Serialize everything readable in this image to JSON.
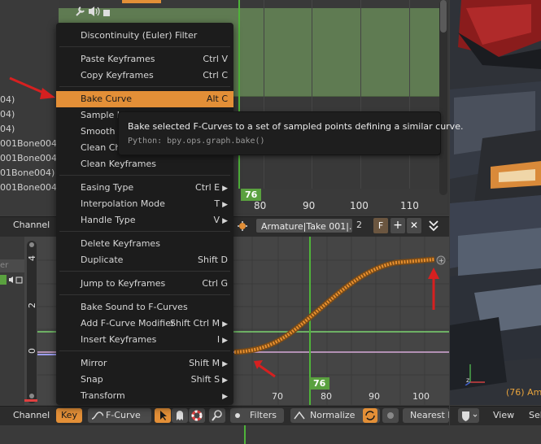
{
  "top_editor": {
    "channel_fragments": [
      "04)",
      "04)",
      "04)",
      "001Bone004)",
      "001Bone004)",
      "01Bone004)",
      "001Bone004)"
    ],
    "ruler_numbers": [
      "80",
      "90",
      "100",
      "110"
    ],
    "current_frame": "76"
  },
  "dopesheet_header": {
    "channel_menu": "Channel",
    "action_name": "Armature|Take 001|..",
    "action_users": "2",
    "fake_user": "F",
    "add_action": "+",
    "delete_action": "✕"
  },
  "graph_editor": {
    "y_ticks": [
      "4",
      "2",
      "0"
    ],
    "x_ticks": [
      "70",
      "80",
      "90",
      "100"
    ],
    "current_frame": "76",
    "channel_fragment": "er"
  },
  "bottom_header": {
    "channel_menu": "Channel",
    "key_menu": "Key",
    "mode": "F-Curve",
    "filters": "Filters",
    "normalize": "Normalize",
    "snap": "Nearest F"
  },
  "viewport": {
    "view_menu": "View",
    "select_menu": "Sel",
    "info_label": "(76) Am"
  },
  "context_menu": {
    "items": [
      {
        "label": "Discontinuity (Euler) Filter",
        "shortcut": ""
      },
      {
        "label": "Paste Keyframes",
        "shortcut": "Ctrl V"
      },
      {
        "label": "Copy Keyframes",
        "shortcut": "Ctrl C"
      },
      {
        "label": "Bake Curve",
        "shortcut": "Alt C"
      },
      {
        "label": "Sample Keyframes",
        "shortcut": ""
      },
      {
        "label": "Smooth Keys",
        "shortcut": ""
      },
      {
        "label": "Clean Channels",
        "shortcut": ""
      },
      {
        "label": "Clean Keyframes",
        "shortcut": ""
      },
      {
        "label": "Easing Type",
        "shortcut": "Ctrl E"
      },
      {
        "label": "Interpolation Mode",
        "shortcut": "T"
      },
      {
        "label": "Handle Type",
        "shortcut": "V"
      },
      {
        "label": "Delete Keyframes",
        "shortcut": ""
      },
      {
        "label": "Duplicate",
        "shortcut": "Shift D"
      },
      {
        "label": "Jump to Keyframes",
        "shortcut": "Ctrl G"
      },
      {
        "label": "Bake Sound to F-Curves",
        "shortcut": ""
      },
      {
        "label": "Add F-Curve Modifier",
        "shortcut": "Shift Ctrl M"
      },
      {
        "label": "Insert Keyframes",
        "shortcut": "I"
      },
      {
        "label": "Mirror",
        "shortcut": "Shift M"
      },
      {
        "label": "Snap",
        "shortcut": "Shift S"
      },
      {
        "label": "Transform",
        "shortcut": ""
      }
    ]
  },
  "tooltip": {
    "description": "Bake selected F-Curves to a set of sampled points defining a similar curve.",
    "python": "Python: bpy.ops.graph.bake()"
  },
  "colors": {
    "highlight": "#e38f37",
    "frame_green": "#5aa13f",
    "curve_orange": "#e8902f",
    "arrow_red": "#d62020"
  }
}
